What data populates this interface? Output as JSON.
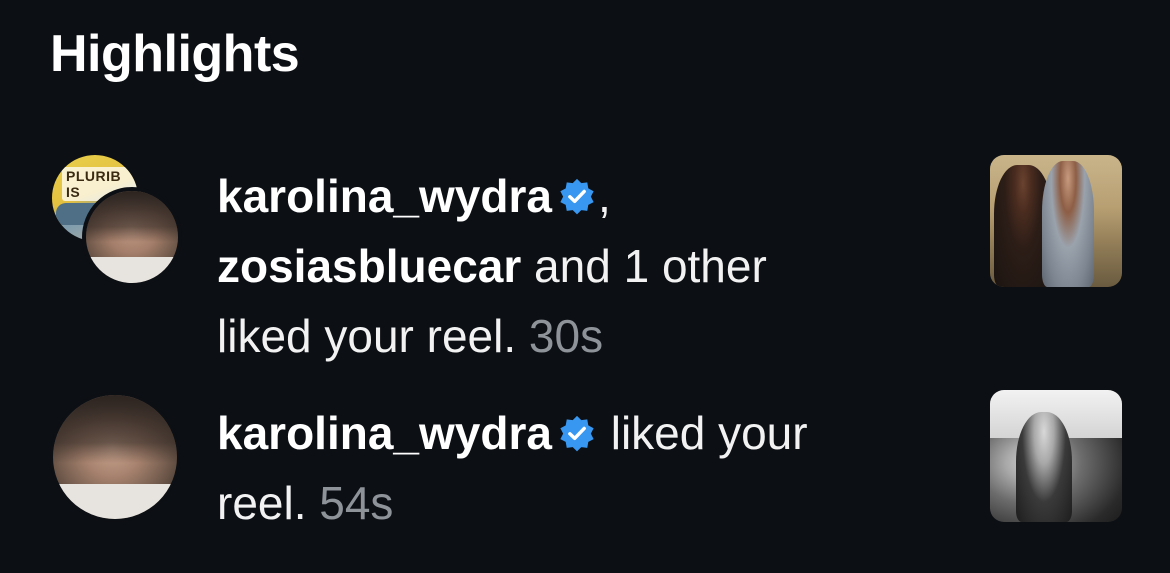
{
  "section": {
    "title": "Highlights"
  },
  "notifications": [
    {
      "user1": "karolina_wydra",
      "comma": ",",
      "user2": "zosiasbluecar",
      "rest": " and 1 other",
      "action": "liked your reel.",
      "time": "30s",
      "avatar_back_label": "PLURIB IS",
      "verified_icon": "verified-badge-icon"
    },
    {
      "user1": "karolina_wydra",
      "action": " liked your",
      "action2": "reel.",
      "time": "54s",
      "verified_icon": "verified-badge-icon"
    }
  ],
  "colors": {
    "background": "#0c0f14",
    "text": "#f2f2f2",
    "muted": "#8e9299",
    "verified": "#3897f0"
  }
}
